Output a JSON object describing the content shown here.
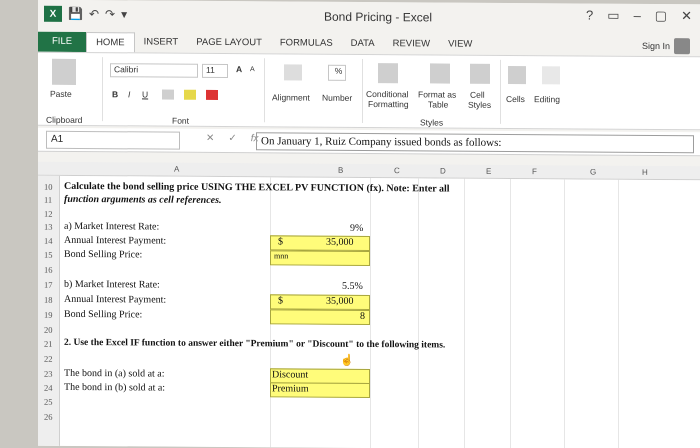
{
  "window": {
    "title": "Bond Pricing - Excel",
    "controls": [
      "?",
      "▭",
      "–",
      "▢",
      "✕"
    ]
  },
  "qat": {
    "logo": "X",
    "save": "💾",
    "undo": "↶",
    "redo": "↷",
    "custom": "▾"
  },
  "tabs": [
    "FILE",
    "HOME",
    "INSERT",
    "PAGE LAYOUT",
    "FORMULAS",
    "DATA",
    "REVIEW",
    "VIEW"
  ],
  "signin": "Sign In",
  "ribbon": {
    "paste": "Paste",
    "font_name": "Calibri",
    "font_size": "11",
    "grow": "A",
    "shrink": "A",
    "bold": "B",
    "italic": "I",
    "underline": "U",
    "alignment": "Alignment",
    "number": "Number",
    "percent": "%",
    "conditional": "Conditional",
    "formatting": "Formatting",
    "format_as": "Format as",
    "table": "Table",
    "cell": "Cell",
    "styles_btn": "Styles",
    "cells": "Cells",
    "editing": "Editing",
    "clipboard_group": "Clipboard",
    "font_group": "Font",
    "styles_group": "Styles"
  },
  "formula_bar": {
    "cell_ref": "A1",
    "fx": "fx",
    "content": "On January 1, Ruiz Company issued bonds as follows:"
  },
  "columns": [
    "A",
    "B",
    "C",
    "D",
    "E",
    "F",
    "G",
    "H"
  ],
  "rows": [
    {
      "num": "10",
      "a": "Calculate the bond selling price USING THE EXCEL PV FUNCTION (fx). Note: Enter all"
    },
    {
      "num": "11",
      "a": "function arguments as cell references."
    },
    {
      "num": "12"
    },
    {
      "num": "13",
      "a": "a)  Market Interest Rate:",
      "val": "9%"
    },
    {
      "num": "14",
      "a": "      Annual Interest Payment:",
      "cur": "$",
      "val": "35,000"
    },
    {
      "num": "15",
      "a": "      Bond Selling Price:",
      "val": "mnn"
    },
    {
      "num": "16"
    },
    {
      "num": "17",
      "a": "b)  Market Interest Rate:",
      "val": "5.5%"
    },
    {
      "num": "18",
      "a": "      Annual Interest Payment:",
      "cur": "$",
      "val": "35,000"
    },
    {
      "num": "19",
      "a": "      Bond Selling Price:",
      "val": "8"
    },
    {
      "num": "20"
    },
    {
      "num": "21",
      "a": "2. Use the Excel IF function to answer either \"Premium\" or \"Discount\" to the following items."
    },
    {
      "num": "22"
    },
    {
      "num": "23",
      "a": "The bond in (a) sold at a:",
      "val": "Discount"
    },
    {
      "num": "24",
      "a": "The bond in (b) sold at a:",
      "val": "Premium"
    },
    {
      "num": "25"
    },
    {
      "num": "26"
    }
  ],
  "colors": {
    "excel_green": "#217346",
    "input_yellow": "#fffc7a"
  }
}
